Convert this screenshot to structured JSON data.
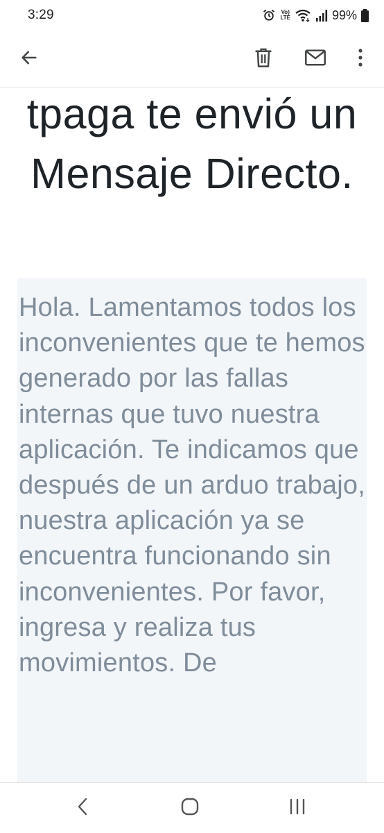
{
  "status_bar": {
    "time": "3:29",
    "volte_top": "Vo)",
    "volte_bottom": "LTE",
    "battery_percent": "99%",
    "icons": [
      "alarm-icon",
      "volte-icon",
      "wifi-icon",
      "signal-icon",
      "battery-icon"
    ]
  },
  "app_bar": {
    "icons": [
      "arrow-back-icon",
      "delete-icon",
      "mail-icon",
      "more-vert-icon"
    ]
  },
  "email": {
    "headline": "tpaga te envió un Mensaje Directo.",
    "body": "Hola. Lamentamos todos los inconvenientes que te hemos generado por las fallas internas que tuvo nuestra aplicación. Te indicamos que después de un arduo trabajo, nuestra aplicación ya se encuentra funcionando sin inconvenientes. Por favor, ingresa y realiza tus movimientos. De"
  },
  "nav_bar": {
    "icons": [
      "nav-back-icon",
      "nav-home-icon",
      "nav-recents-icon"
    ]
  },
  "colors": {
    "headline": "#1e2328",
    "body_text": "#7f8c99",
    "message_bg": "#f3f6f9",
    "icon": "#444746"
  }
}
